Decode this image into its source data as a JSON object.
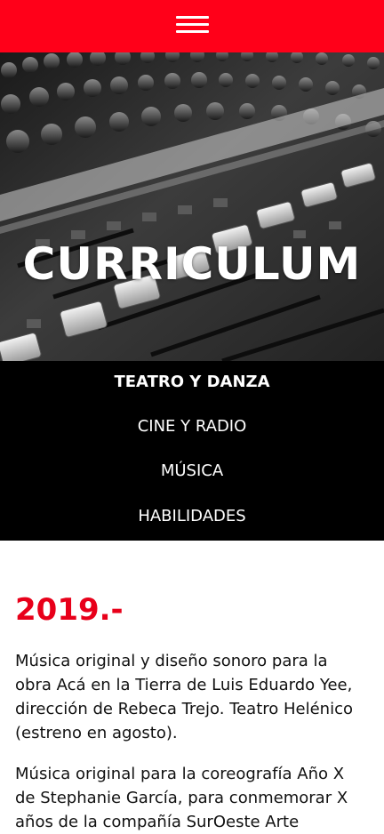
{
  "header": {
    "menu_icon": "hamburger-menu-icon",
    "bg_color": "#ff0019"
  },
  "hero": {
    "title": "CURRICULUM",
    "image": "mixing-console-photo"
  },
  "subnav": {
    "items": [
      {
        "label": "TEATRO Y DANZA",
        "active": true
      },
      {
        "label": "CINE Y RADIO",
        "active": false
      },
      {
        "label": "MÚSICA",
        "active": false
      },
      {
        "label": "HABILIDADES",
        "active": false
      }
    ]
  },
  "content": {
    "year": "2019.-",
    "paragraphs": [
      "Música original y diseño sonoro para la obra Acá en la Tierra de Luis Eduardo Yee, dirección de Rebeca Trejo. Teatro Helénico (estreno en agosto).",
      "Música original para la coreografía Año X de Stephanie García, para conmemorar X años de la compañía SurOeste Arte"
    ]
  },
  "colors": {
    "accent": "#e8001a",
    "nav_bg": "#000000",
    "text": "#111111"
  }
}
